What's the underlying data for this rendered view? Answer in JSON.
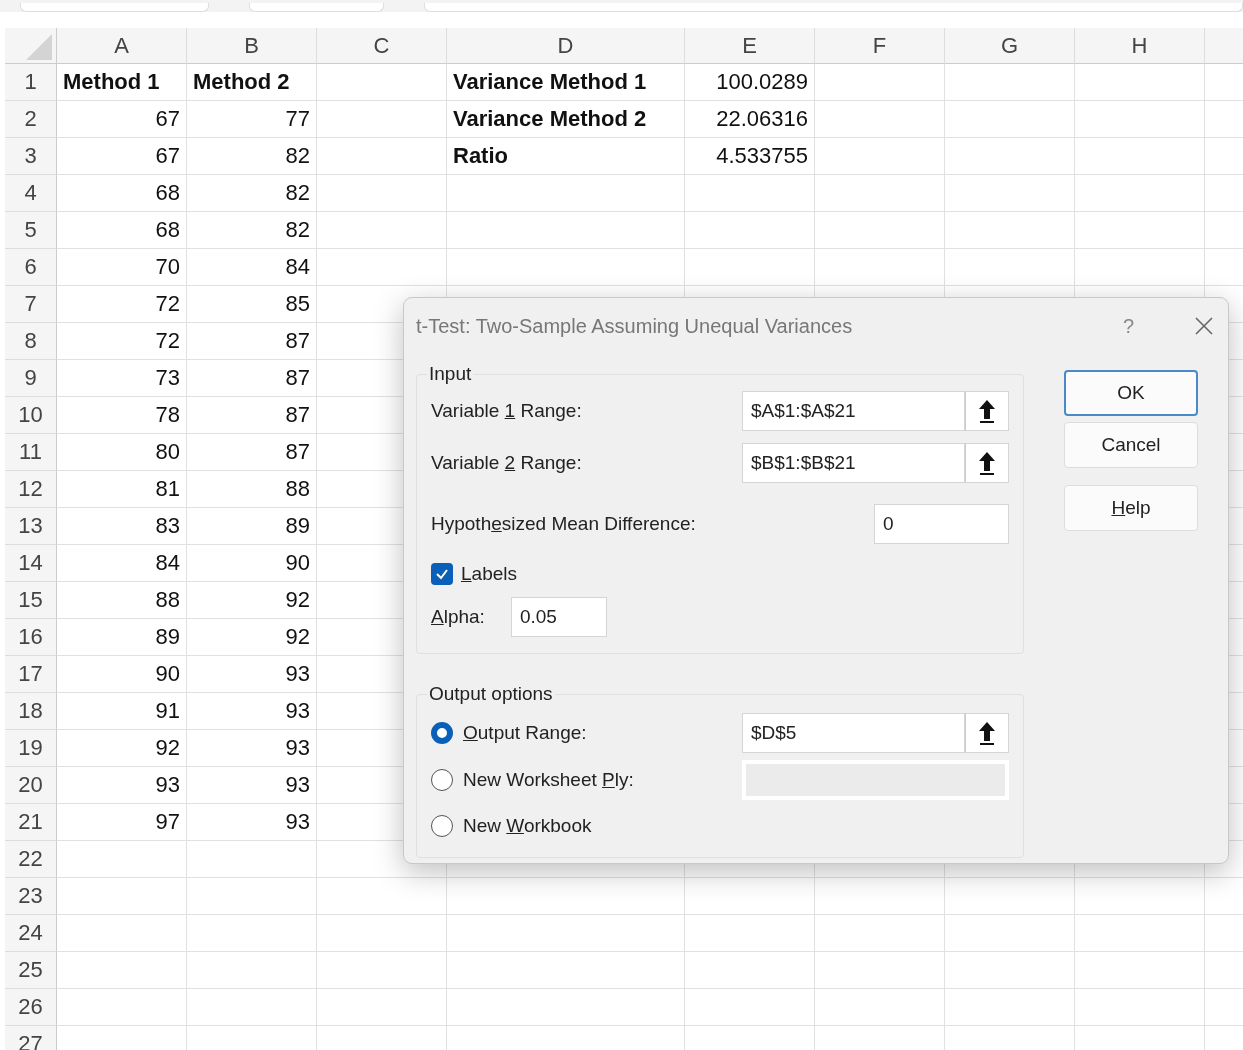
{
  "sheet": {
    "columns": [
      "A",
      "B",
      "C",
      "D",
      "E",
      "F",
      "G",
      "H"
    ],
    "rows": [
      {
        "number": "1",
        "cells": [
          {
            "text": "Method 1",
            "kind": "label"
          },
          {
            "text": "Method 2",
            "kind": "label"
          },
          null,
          {
            "text": "Variance Method 1",
            "kind": "label"
          },
          {
            "text": "100.0289",
            "kind": "number"
          }
        ]
      },
      {
        "number": "2",
        "cells": [
          {
            "text": "67",
            "kind": "number"
          },
          {
            "text": "77",
            "kind": "number"
          },
          null,
          {
            "text": "Variance Method 2",
            "kind": "label"
          },
          {
            "text": "22.06316",
            "kind": "number"
          }
        ]
      },
      {
        "number": "3",
        "cells": [
          {
            "text": "67",
            "kind": "number"
          },
          {
            "text": "82",
            "kind": "number"
          },
          null,
          {
            "text": "Ratio",
            "kind": "label"
          },
          {
            "text": "4.533755",
            "kind": "number"
          }
        ]
      },
      {
        "number": "4",
        "cells": [
          {
            "text": "68",
            "kind": "number"
          },
          {
            "text": "82",
            "kind": "number"
          }
        ]
      },
      {
        "number": "5",
        "cells": [
          {
            "text": "68",
            "kind": "number"
          },
          {
            "text": "82",
            "kind": "number"
          }
        ]
      },
      {
        "number": "6",
        "cells": [
          {
            "text": "70",
            "kind": "number"
          },
          {
            "text": "84",
            "kind": "number"
          }
        ]
      },
      {
        "number": "7",
        "cells": [
          {
            "text": "72",
            "kind": "number"
          },
          {
            "text": "85",
            "kind": "number"
          }
        ]
      },
      {
        "number": "8",
        "cells": [
          {
            "text": "72",
            "kind": "number"
          },
          {
            "text": "87",
            "kind": "number"
          }
        ]
      },
      {
        "number": "9",
        "cells": [
          {
            "text": "73",
            "kind": "number"
          },
          {
            "text": "87",
            "kind": "number"
          }
        ]
      },
      {
        "number": "10",
        "cells": [
          {
            "text": "78",
            "kind": "number"
          },
          {
            "text": "87",
            "kind": "number"
          }
        ]
      },
      {
        "number": "11",
        "cells": [
          {
            "text": "80",
            "kind": "number"
          },
          {
            "text": "87",
            "kind": "number"
          }
        ]
      },
      {
        "number": "12",
        "cells": [
          {
            "text": "81",
            "kind": "number"
          },
          {
            "text": "88",
            "kind": "number"
          }
        ]
      },
      {
        "number": "13",
        "cells": [
          {
            "text": "83",
            "kind": "number"
          },
          {
            "text": "89",
            "kind": "number"
          }
        ]
      },
      {
        "number": "14",
        "cells": [
          {
            "text": "84",
            "kind": "number"
          },
          {
            "text": "90",
            "kind": "number"
          }
        ]
      },
      {
        "number": "15",
        "cells": [
          {
            "text": "88",
            "kind": "number"
          },
          {
            "text": "92",
            "kind": "number"
          }
        ]
      },
      {
        "number": "16",
        "cells": [
          {
            "text": "89",
            "kind": "number"
          },
          {
            "text": "92",
            "kind": "number"
          }
        ]
      },
      {
        "number": "17",
        "cells": [
          {
            "text": "90",
            "kind": "number"
          },
          {
            "text": "93",
            "kind": "number"
          }
        ]
      },
      {
        "number": "18",
        "cells": [
          {
            "text": "91",
            "kind": "number"
          },
          {
            "text": "93",
            "kind": "number"
          }
        ]
      },
      {
        "number": "19",
        "cells": [
          {
            "text": "92",
            "kind": "number"
          },
          {
            "text": "93",
            "kind": "number"
          }
        ]
      },
      {
        "number": "20",
        "cells": [
          {
            "text": "93",
            "kind": "number"
          },
          {
            "text": "93",
            "kind": "number"
          }
        ]
      },
      {
        "number": "21",
        "cells": [
          {
            "text": "97",
            "kind": "number"
          },
          {
            "text": "93",
            "kind": "number"
          }
        ]
      },
      {
        "number": "22"
      },
      {
        "number": "23"
      },
      {
        "number": "24"
      },
      {
        "number": "25"
      },
      {
        "number": "26"
      },
      {
        "number": "27"
      }
    ]
  },
  "dialog": {
    "title": "t-Test: Two-Sample Assuming Unequal Variances",
    "help_glyph": "?",
    "input": {
      "title": "Input",
      "variable_1": {
        "label_start": "Variable ",
        "access_key": "1",
        "label_end": " Range:",
        "value": "$A$1:$A$21"
      },
      "variable_2": {
        "label_start": "Variable ",
        "access_key": "2",
        "label_end": " Range:",
        "value": "$B$1:$B$21"
      },
      "mean_difference": {
        "label_start": "Hypoth",
        "access_key": "e",
        "label_end": "sized Mean Difference:",
        "value": "0"
      },
      "labels": {
        "access_key": "L",
        "label_end": "abels",
        "checked": true
      },
      "alpha": {
        "access_key": "A",
        "label_end": "lpha:",
        "value": "0.05"
      }
    },
    "output": {
      "title": "Output options",
      "options": [
        {
          "access_key": "O",
          "label_end": "utput Range:",
          "selected": true,
          "value": "$D$5",
          "disabled": false
        },
        {
          "label_start": "New Worksheet ",
          "access_key": "P",
          "label_end": "ly:",
          "selected": false,
          "disabled": true
        },
        {
          "label_start": "New ",
          "access_key": "W",
          "label_end": "orkbook",
          "selected": false
        }
      ]
    },
    "buttons": [
      {
        "label_end": "OK",
        "default": true
      },
      {
        "label_end": "Cancel",
        "default": false
      },
      {
        "access_key": "H",
        "label_end": "elp",
        "default": false
      }
    ]
  }
}
